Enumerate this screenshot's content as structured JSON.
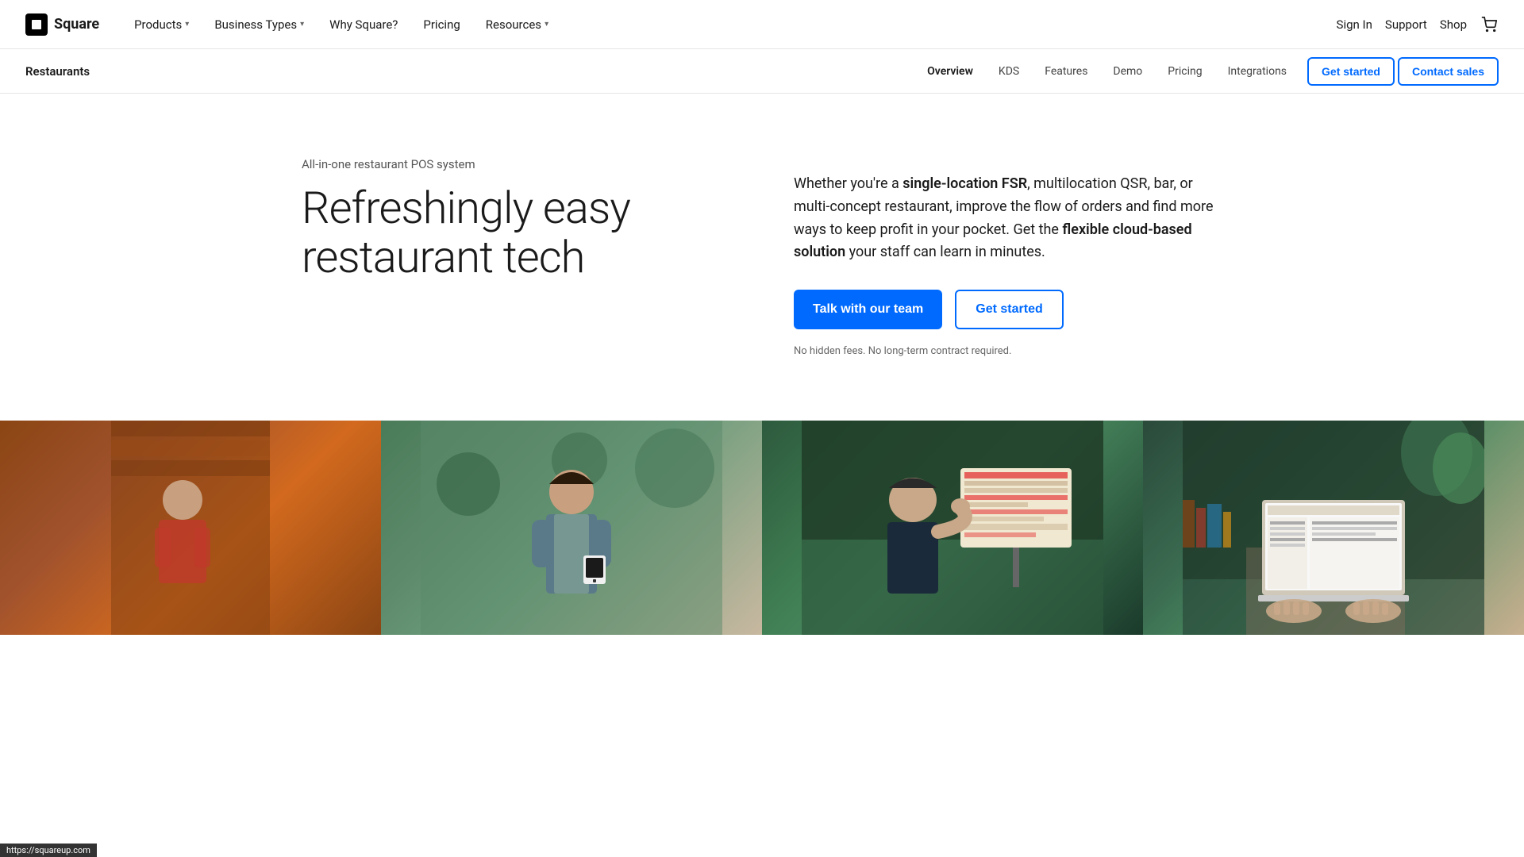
{
  "logo": {
    "text": "Square"
  },
  "topNav": {
    "items": [
      {
        "label": "Products",
        "hasDropdown": true
      },
      {
        "label": "Business Types",
        "hasDropdown": true
      },
      {
        "label": "Why Square?",
        "hasDropdown": false
      },
      {
        "label": "Pricing",
        "hasDropdown": false
      },
      {
        "label": "Resources",
        "hasDropdown": true
      }
    ],
    "rightItems": [
      {
        "label": "Sign In"
      },
      {
        "label": "Support"
      },
      {
        "label": "Shop"
      }
    ]
  },
  "subNav": {
    "brand": "Restaurants",
    "items": [
      {
        "label": "Overview",
        "active": true
      },
      {
        "label": "KDS",
        "active": false
      },
      {
        "label": "Features",
        "active": false
      },
      {
        "label": "Demo",
        "active": false
      },
      {
        "label": "Pricing",
        "active": false
      },
      {
        "label": "Integrations",
        "active": false
      }
    ],
    "getStartedLabel": "Get started",
    "contactSalesLabel": "Contact sales"
  },
  "hero": {
    "eyebrow": "All-in-one restaurant POS system",
    "title": "Refreshingly easy restaurant tech",
    "description": "Whether you're a single-location FSR, multilocation QSR, bar, or multi-concept restaurant, improve the flow of orders and find more ways to keep profit in your pocket. Get the flexible cloud-based solution your staff can learn in minutes.",
    "ctaPrimary": "Talk with our team",
    "ctaSecondary": "Get started",
    "disclaimer": "No hidden fees. No long-term contract required."
  },
  "statusBar": {
    "url": "https://squareup.com"
  },
  "images": [
    {
      "id": "kitchen",
      "alt": "Kitchen worker at restaurant"
    },
    {
      "id": "server",
      "alt": "Server with payment device"
    },
    {
      "id": "pos-screen",
      "alt": "Worker using POS screen"
    },
    {
      "id": "laptop",
      "alt": "Person using laptop"
    }
  ]
}
